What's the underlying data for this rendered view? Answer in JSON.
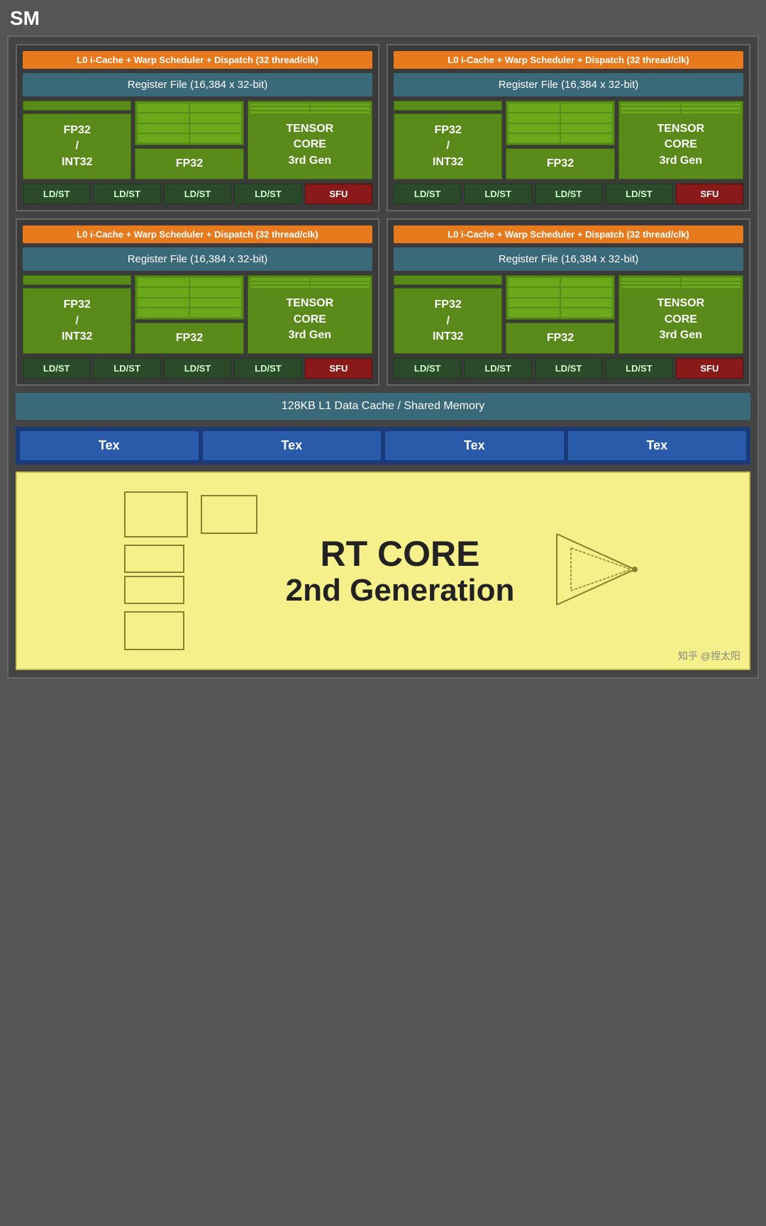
{
  "sm_label": "SM",
  "quadrants": [
    {
      "l0_cache": "L0 i-Cache + Warp Scheduler + Dispatch (32 thread/clk)",
      "register_file": "Register File (16,384 x 32-bit)",
      "fp32_label": "FP32\n/\nINT32",
      "fp32_label2": "FP32",
      "tensor_label": "TENSOR\nCORE\n3rd Gen",
      "ldst_labels": [
        "LD/ST",
        "LD/ST",
        "LD/ST",
        "LD/ST"
      ],
      "sfu_label": "SFU"
    },
    {
      "l0_cache": "L0 i-Cache + Warp Scheduler + Dispatch (32 thread/clk)",
      "register_file": "Register File (16,384 x 32-bit)",
      "fp32_label": "FP32\n/\nINT32",
      "fp32_label2": "FP32",
      "tensor_label": "TENSOR\nCORE\n3rd Gen",
      "ldst_labels": [
        "LD/ST",
        "LD/ST",
        "LD/ST",
        "LD/ST"
      ],
      "sfu_label": "SFU"
    },
    {
      "l0_cache": "L0 i-Cache + Warp Scheduler + Dispatch (32 thread/clk)",
      "register_file": "Register File (16,384 x 32-bit)",
      "fp32_label": "FP32\n/\nINT32",
      "fp32_label2": "FP32",
      "tensor_label": "TENSOR\nCORE\n3rd Gen",
      "ldst_labels": [
        "LD/ST",
        "LD/ST",
        "LD/ST",
        "LD/ST"
      ],
      "sfu_label": "SFU"
    },
    {
      "l0_cache": "L0 i-Cache + Warp Scheduler + Dispatch (32 thread/clk)",
      "register_file": "Register File (16,384 x 32-bit)",
      "fp32_label": "FP32\n/\nINT32",
      "fp32_label2": "FP32",
      "tensor_label": "TENSOR\nCORE\n3rd Gen",
      "ldst_labels": [
        "LD/ST",
        "LD/ST",
        "LD/ST",
        "LD/ST"
      ],
      "sfu_label": "SFU"
    }
  ],
  "l1_cache": "128KB L1 Data Cache / Shared Memory",
  "tex_labels": [
    "Tex",
    "Tex",
    "Tex",
    "Tex"
  ],
  "rt_core_line1": "RT CORE",
  "rt_core_line2": "2nd Generation",
  "watermark": "知乎 @捏太阳"
}
